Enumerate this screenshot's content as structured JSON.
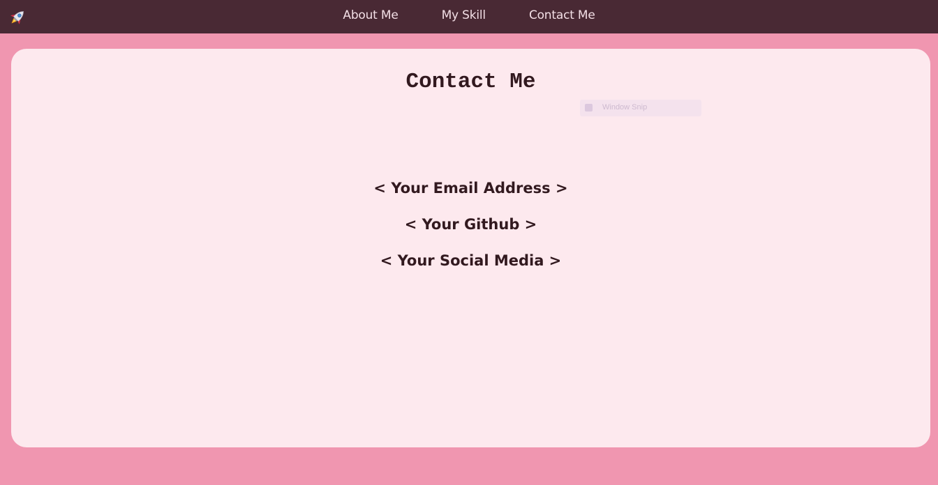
{
  "nav": {
    "logo_icon": "rocket-icon",
    "links": [
      {
        "label": "About Me"
      },
      {
        "label": "My Skill"
      },
      {
        "label": "Contact Me"
      }
    ]
  },
  "main": {
    "title": "Contact Me",
    "snip_overlay": {
      "label": "Window Snip"
    },
    "contacts": [
      {
        "label": "< Your Email Address >"
      },
      {
        "label": "< Your Github >"
      },
      {
        "label": "< Your Social Media >"
      }
    ]
  },
  "colors": {
    "page_background": "#f096b0",
    "navbar_background": "#492934",
    "card_background": "#fde9ee",
    "text_dark": "#32191f",
    "nav_text": "#f3dfe6"
  }
}
